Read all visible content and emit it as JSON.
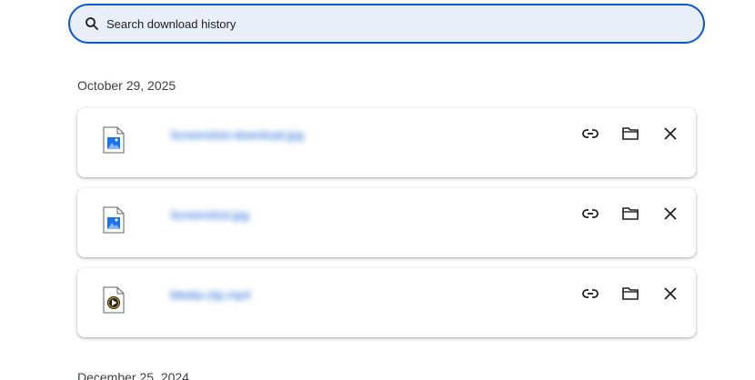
{
  "search": {
    "placeholder": "Search download history",
    "icon": "search-icon"
  },
  "groups": [
    {
      "date": "October 29, 2025",
      "items": [
        {
          "name": "Screenshot-download.jpg",
          "file_type": "image",
          "icon": "image-file-icon"
        },
        {
          "name": "Screenshot.jpg",
          "file_type": "image",
          "icon": "image-file-icon"
        },
        {
          "name": "Media-clip.mp4",
          "file_type": "video",
          "icon": "video-file-icon"
        }
      ]
    },
    {
      "date": "December 25, 2024",
      "items": []
    }
  ],
  "actions": {
    "copy_link": "link-icon",
    "show_in_folder": "folder-icon",
    "remove": "close-icon"
  },
  "colors": {
    "accent": "#0b57d0",
    "search_bg": "#e9eef8",
    "image_icon": "#1a73e8"
  }
}
